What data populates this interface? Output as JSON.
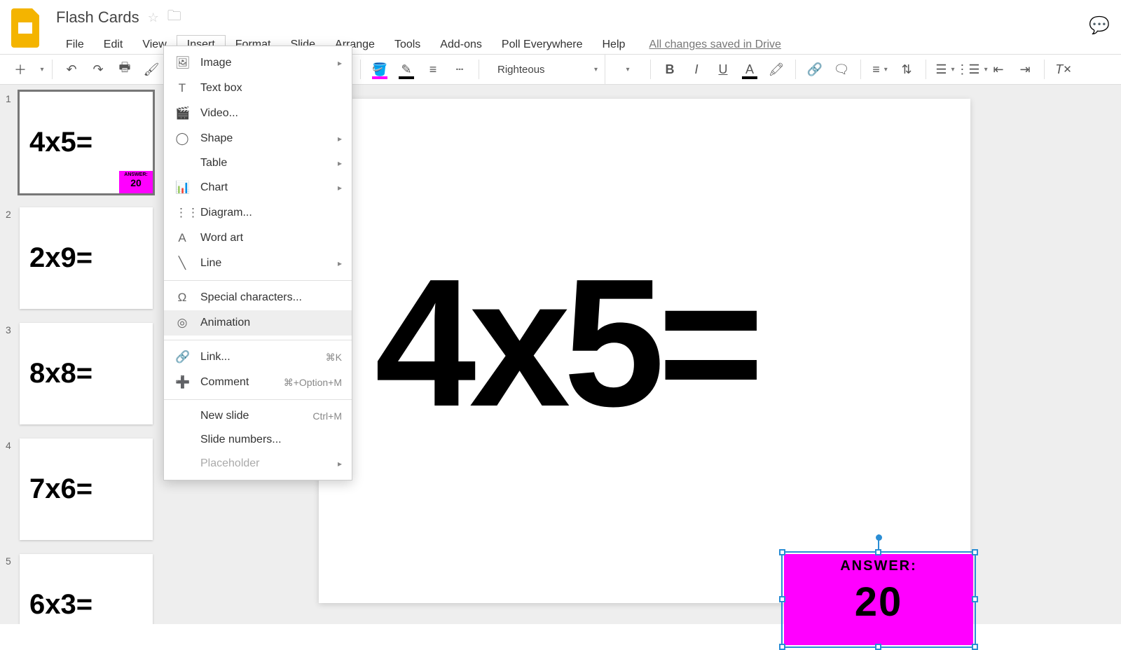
{
  "doc": {
    "title": "Flash Cards",
    "save_status": "All changes saved in Drive"
  },
  "menubar": [
    "File",
    "Edit",
    "View",
    "Insert",
    "Format",
    "Slide",
    "Arrange",
    "Tools",
    "Add-ons",
    "Poll Everywhere",
    "Help"
  ],
  "active_menu_index": 3,
  "toolbar": {
    "font": "Righteous"
  },
  "insert_menu": {
    "items": [
      {
        "icon": "🖼",
        "label": "Image",
        "arrow": true
      },
      {
        "icon": "T",
        "label": "Text box"
      },
      {
        "icon": "🎬",
        "label": "Video..."
      },
      {
        "icon": "◯",
        "label": "Shape",
        "arrow": true
      },
      {
        "icon": "",
        "label": "Table",
        "arrow": true
      },
      {
        "icon": "📊",
        "label": "Chart",
        "arrow": true
      },
      {
        "icon": "⋮⋮",
        "label": "Diagram..."
      },
      {
        "icon": "A",
        "label": "Word art"
      },
      {
        "icon": "╲",
        "label": "Line",
        "arrow": true
      },
      {
        "sep": true
      },
      {
        "icon": "Ω",
        "label": "Special characters..."
      },
      {
        "icon": "◎",
        "label": "Animation",
        "hover": true
      },
      {
        "sep": true
      },
      {
        "icon": "🔗",
        "label": "Link...",
        "shortcut": "⌘K"
      },
      {
        "icon": "➕",
        "label": "Comment",
        "shortcut": "⌘+Option+M"
      },
      {
        "sep": true
      },
      {
        "icon": "",
        "label": "New slide",
        "shortcut": "Ctrl+M"
      },
      {
        "icon": "",
        "label": "Slide numbers..."
      },
      {
        "icon": "",
        "label": "Placeholder",
        "arrow": true,
        "disabled": true
      }
    ]
  },
  "slides": [
    {
      "text": "4x5=",
      "answer": "20",
      "selected": true
    },
    {
      "text": "2x9="
    },
    {
      "text": "8x8="
    },
    {
      "text": "7x6="
    },
    {
      "text": "6x3="
    }
  ],
  "canvas": {
    "main_text": "4x5=",
    "answer_label": "ANSWER:",
    "answer_value": "20"
  }
}
